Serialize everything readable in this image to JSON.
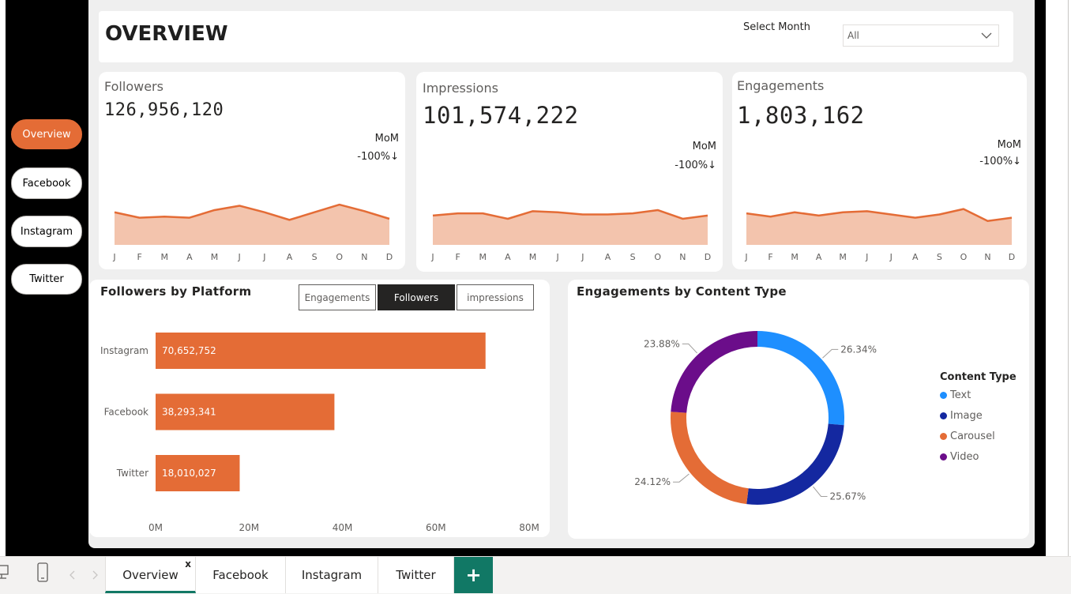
{
  "page": {
    "title": "OVERVIEW"
  },
  "filter": {
    "label": "Select Month",
    "value": "All"
  },
  "nav": {
    "items": [
      {
        "label": "Overview",
        "active": true
      },
      {
        "label": "Facebook",
        "active": false
      },
      {
        "label": "Instagram",
        "active": false
      },
      {
        "label": "Twitter",
        "active": false
      }
    ]
  },
  "kpis": [
    {
      "label": "Followers",
      "value": "126,956,120",
      "mom_label": "MoM",
      "mom_value": "-100%↓"
    },
    {
      "label": "Impressions",
      "value": "101,574,222",
      "mom_label": "MoM",
      "mom_value": "-100%↓"
    },
    {
      "label": "Engagements",
      "value": "1,803,162",
      "mom_label": "MoM",
      "mom_value": "-100%↓"
    }
  ],
  "platform_visual": {
    "title": "Followers by Platform",
    "toggles": [
      {
        "label": "Engagements",
        "active": false
      },
      {
        "label": "Followers",
        "active": true
      },
      {
        "label": "impressions",
        "active": false
      }
    ]
  },
  "content_visual": {
    "title": "Engagements by Content Type",
    "legend_title": "Content Type"
  },
  "tabs": [
    {
      "label": "Overview",
      "active": true,
      "close": "x"
    },
    {
      "label": "Facebook",
      "active": false
    },
    {
      "label": "Instagram",
      "active": false
    },
    {
      "label": "Twitter",
      "active": false
    }
  ],
  "add_tab_label": "+",
  "colors": {
    "accent": "#e46c36",
    "area_fill": "#f3c4ad",
    "text": "#1e8fff",
    "image": "#1428a0",
    "carousel": "#e46c36",
    "video": "#6b0d8a",
    "tab_green": "#117865"
  },
  "chart_data": [
    {
      "type": "area",
      "name": "followers-sparkline",
      "categories": [
        "J",
        "F",
        "M",
        "A",
        "M",
        "J",
        "J",
        "A",
        "S",
        "O",
        "N",
        "D"
      ],
      "values": [
        59,
        54,
        55,
        54,
        61,
        65,
        59,
        52,
        59,
        66,
        60,
        53
      ],
      "ylim": [
        0,
        100
      ],
      "grid": false
    },
    {
      "type": "area",
      "name": "impressions-sparkline",
      "categories": [
        "J",
        "F",
        "M",
        "A",
        "M",
        "J",
        "J",
        "A",
        "S",
        "O",
        "N",
        "D"
      ],
      "values": [
        56,
        58,
        58,
        53,
        60,
        59,
        57,
        57,
        58,
        61,
        53,
        56
      ],
      "ylim": [
        0,
        100
      ],
      "grid": false
    },
    {
      "type": "area",
      "name": "engagements-sparkline",
      "categories": [
        "J",
        "F",
        "M",
        "A",
        "M",
        "J",
        "J",
        "A",
        "S",
        "O",
        "N",
        "D"
      ],
      "values": [
        58,
        55,
        59,
        56,
        59,
        60,
        57,
        54,
        57,
        62,
        51,
        54
      ],
      "ylim": [
        0,
        100
      ],
      "grid": false
    },
    {
      "type": "bar",
      "orientation": "horizontal",
      "categories": [
        "Instagram",
        "Facebook",
        "Twitter"
      ],
      "values": [
        70652752,
        38293341,
        18010027
      ],
      "labels": [
        "70,652,752",
        "38,293,341",
        "18,010,027"
      ],
      "xlim": [
        0,
        80000000
      ],
      "ticks": [
        "0M",
        "20M",
        "40M",
        "60M",
        "80M"
      ],
      "grid": false
    },
    {
      "type": "pie",
      "donut": true,
      "legend": "right",
      "categories": [
        "Text",
        "Image",
        "Carousel",
        "Video"
      ],
      "values": [
        26.34,
        25.67,
        24.12,
        23.88
      ],
      "labels": [
        "26.34%",
        "25.67%",
        "24.12%",
        "23.88%"
      ]
    }
  ]
}
